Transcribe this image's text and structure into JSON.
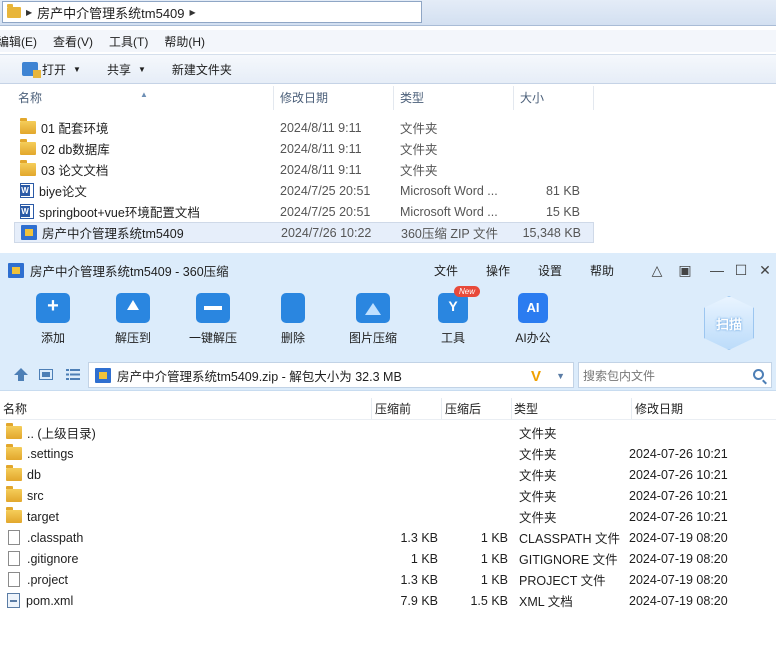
{
  "explorer": {
    "breadcrumb": "房产中介管理系统tm5409",
    "menu": [
      "编辑(E)",
      "查看(V)",
      "工具(T)",
      "帮助(H)"
    ],
    "commands": {
      "open": "打开",
      "share": "共享",
      "new_folder": "新建文件夹"
    },
    "columns": [
      "名称",
      "修改日期",
      "类型",
      "大小"
    ],
    "rows": [
      {
        "icon": "folder-icon",
        "name": "01 配套环境",
        "date": "2024/8/11 9:11",
        "type": "文件夹",
        "size": ""
      },
      {
        "icon": "folder-icon",
        "name": "02 db数据库",
        "date": "2024/8/11 9:11",
        "type": "文件夹",
        "size": ""
      },
      {
        "icon": "folder-icon",
        "name": "03 论文文档",
        "date": "2024/8/11 9:11",
        "type": "文件夹",
        "size": ""
      },
      {
        "icon": "word-doc-icon",
        "name": "biye论文",
        "date": "2024/7/25 20:51",
        "type": "Microsoft Word ...",
        "size": "81 KB"
      },
      {
        "icon": "word-doc-icon",
        "name": "springboot+vue环境配置文档",
        "date": "2024/7/25 20:51",
        "type": "Microsoft Word ...",
        "size": "15 KB"
      },
      {
        "icon": "zip-archive-icon",
        "name": "房产中介管理系统tm5409",
        "date": "2024/7/26 10:22",
        "type": "360压缩 ZIP 文件",
        "size": "15,348 KB",
        "selected": true
      }
    ]
  },
  "zip": {
    "title": "房产中介管理系统tm5409 - 360压缩",
    "menu": [
      "文件",
      "操作",
      "设置",
      "帮助"
    ],
    "toolbar": [
      "添加",
      "解压到",
      "一键解压",
      "删除",
      "图片压缩",
      "工具",
      "AI办公"
    ],
    "new_badge": "New",
    "scan_label": "扫描",
    "path": "房产中介管理系统tm5409.zip - 解包大小为 32.3 MB",
    "search_placeholder": "搜索包内文件",
    "columns": [
      "名称",
      "压缩前",
      "压缩后",
      "类型",
      "修改日期"
    ],
    "rows": [
      {
        "icon": "folder-icon",
        "name": ".. (上级目录)",
        "before": "",
        "after": "",
        "type": "文件夹",
        "date": ""
      },
      {
        "icon": "folder-icon",
        "name": ".settings",
        "before": "",
        "after": "",
        "type": "文件夹",
        "date": "2024-07-26 10:21"
      },
      {
        "icon": "folder-icon",
        "name": "db",
        "before": "",
        "after": "",
        "type": "文件夹",
        "date": "2024-07-26 10:21"
      },
      {
        "icon": "folder-icon",
        "name": "src",
        "before": "",
        "after": "",
        "type": "文件夹",
        "date": "2024-07-26 10:21"
      },
      {
        "icon": "folder-icon",
        "name": "target",
        "before": "",
        "after": "",
        "type": "文件夹",
        "date": "2024-07-26 10:21"
      },
      {
        "icon": "file-icon",
        "name": ".classpath",
        "before": "1.3 KB",
        "after": "1 KB",
        "type": "CLASSPATH 文件",
        "date": "2024-07-19 08:20"
      },
      {
        "icon": "file-icon",
        "name": ".gitignore",
        "before": "1 KB",
        "after": "1 KB",
        "type": "GITIGNORE 文件",
        "date": "2024-07-19 08:20"
      },
      {
        "icon": "file-icon",
        "name": ".project",
        "before": "1.3 KB",
        "after": "1 KB",
        "type": "PROJECT 文件",
        "date": "2024-07-19 08:20"
      },
      {
        "icon": "xml-file-icon",
        "name": "pom.xml",
        "before": "7.9 KB",
        "after": "1.5 KB",
        "type": "XML 文档",
        "date": "2024-07-19 08:20"
      }
    ]
  }
}
